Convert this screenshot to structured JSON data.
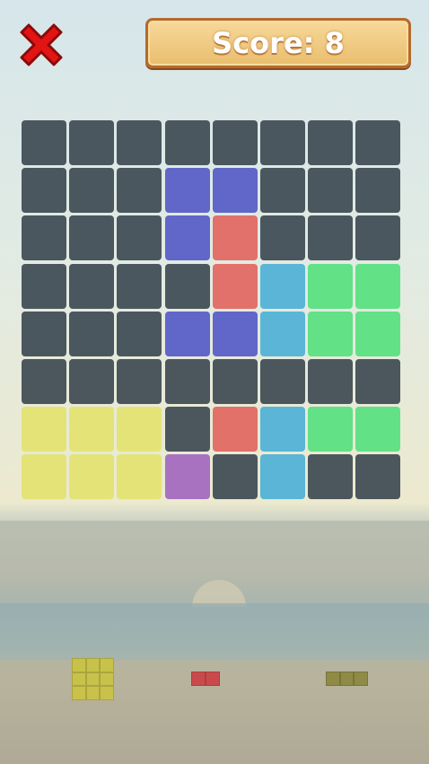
{
  "header": {
    "close_icon": "close-x-icon",
    "score_label": "Score: 8"
  },
  "colors": {
    "empty": "#3e4a52",
    "blue": "#5a5fc7",
    "red": "#e06a63",
    "cyan": "#53b2d6",
    "green": "#5be082",
    "yellow": "#e4e373",
    "purple": "#a46cc0",
    "close_red": "#e01010"
  },
  "board": {
    "rows": 8,
    "cols": 8,
    "grid": [
      [
        "E",
        "E",
        "E",
        "E",
        "E",
        "E",
        "E",
        "E"
      ],
      [
        "E",
        "E",
        "E",
        "B",
        "B",
        "E",
        "E",
        "E"
      ],
      [
        "E",
        "E",
        "E",
        "B",
        "R",
        "E",
        "E",
        "E"
      ],
      [
        "E",
        "E",
        "E",
        "E",
        "R",
        "C",
        "G",
        "G"
      ],
      [
        "E",
        "E",
        "E",
        "B",
        "B",
        "C",
        "G",
        "G"
      ],
      [
        "E",
        "E",
        "E",
        "E",
        "E",
        "E",
        "E",
        "E"
      ],
      [
        "Y",
        "Y",
        "Y",
        "E",
        "R",
        "C",
        "G",
        "G"
      ],
      [
        "Y",
        "Y",
        "Y",
        "P",
        "E",
        "C",
        "E",
        "E"
      ]
    ]
  },
  "tray": {
    "pieces": [
      {
        "name": "yellow-square-piece",
        "color": "#c8c24a",
        "rows": 3,
        "cols": 3
      },
      {
        "name": "red-domino-piece",
        "color": "#c94a4a",
        "rows": 1,
        "cols": 2
      },
      {
        "name": "olive-line-piece",
        "color": "#8f8a45",
        "rows": 1,
        "cols": 3
      }
    ]
  }
}
